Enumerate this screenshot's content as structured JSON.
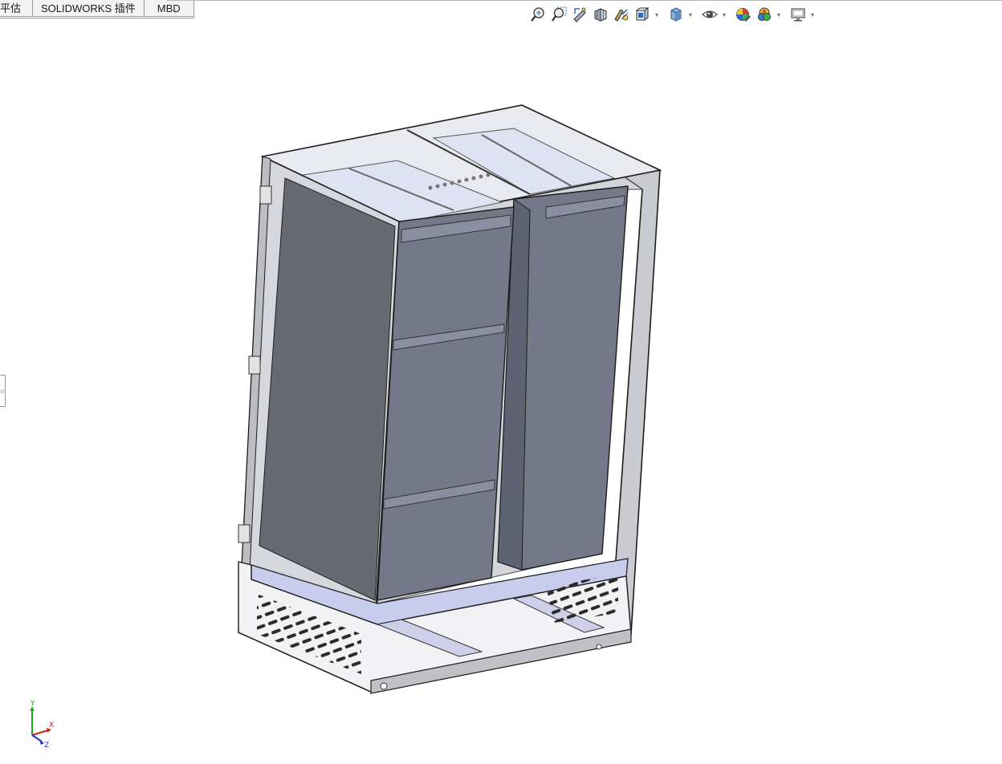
{
  "tabs": [
    {
      "label": "平估"
    },
    {
      "label": "SOLIDWORKS 插件"
    },
    {
      "label": "MBD"
    }
  ],
  "heads_up_toolbar": [
    {
      "icon": "zoom-to-fit-icon",
      "has_dropdown": false
    },
    {
      "icon": "zoom-to-area-icon",
      "has_dropdown": false
    },
    {
      "icon": "previous-view-icon",
      "has_dropdown": false
    },
    {
      "icon": "section-view-icon",
      "has_dropdown": false
    },
    {
      "icon": "dynamic-annotation-views-icon",
      "has_dropdown": false
    },
    {
      "icon": "view-orientation-icon",
      "has_dropdown": true
    },
    {
      "icon": "display-style-icon",
      "has_dropdown": true
    },
    {
      "icon": "hide-show-items-icon",
      "has_dropdown": true
    },
    {
      "icon": "edit-appearance-icon",
      "has_dropdown": false
    },
    {
      "icon": "apply-scene-icon",
      "has_dropdown": true
    },
    {
      "icon": "view-settings-icon",
      "has_dropdown": true
    }
  ],
  "triad": {
    "x_label": "X",
    "y_label": "Y",
    "z_label": "Z"
  },
  "colors": {
    "background": "#ffffff",
    "body_edge": "#1c1c1c",
    "glass": "#c8cad0",
    "bin_face": "#747888",
    "bin_top": "#dfe2f2",
    "floor": "#c8cdee",
    "triad_x": "#cc2222",
    "triad_y": "#22aa22",
    "triad_z": "#2233cc"
  }
}
